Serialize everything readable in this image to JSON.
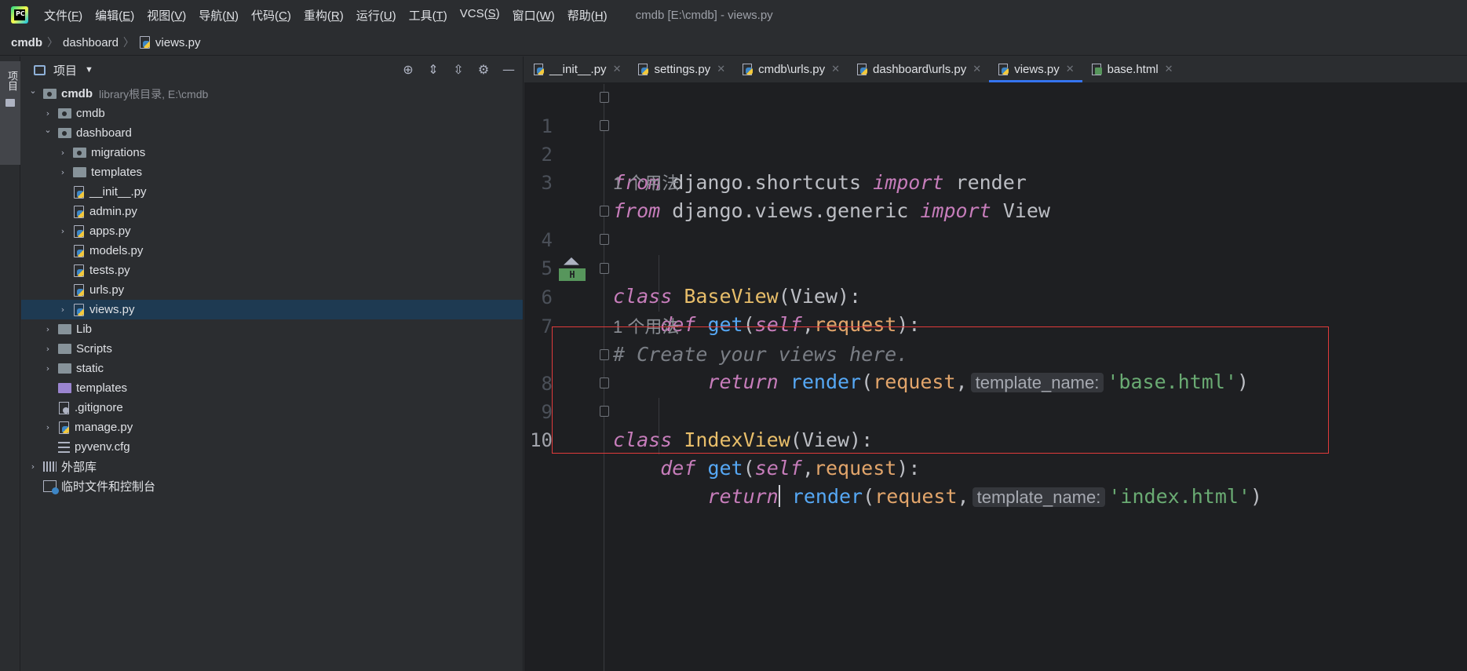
{
  "menubar": {
    "logo_text": "PC",
    "items": [
      {
        "label": "文件(",
        "key": "F",
        "end": ")"
      },
      {
        "label": "编辑(",
        "key": "E",
        "end": ")"
      },
      {
        "label": "视图(",
        "key": "V",
        "end": ")"
      },
      {
        "label": "导航(",
        "key": "N",
        "end": ")"
      },
      {
        "label": "代码(",
        "key": "C",
        "end": ")"
      },
      {
        "label": "重构(",
        "key": "R",
        "end": ")"
      },
      {
        "label": "运行(",
        "key": "U",
        "end": ")"
      },
      {
        "label": "工具(",
        "key": "T",
        "end": ")"
      },
      {
        "label": "VCS(",
        "key": "S",
        "end": ")"
      },
      {
        "label": "窗口(",
        "key": "W",
        "end": ")"
      },
      {
        "label": "帮助(",
        "key": "H",
        "end": ")"
      }
    ],
    "window_title": "cmdb [E:\\cmdb] - views.py"
  },
  "breadcrumb": {
    "items": [
      "cmdb",
      "dashboard",
      "views.py"
    ]
  },
  "toolstrip": {
    "project_tab": "项目"
  },
  "project_panel": {
    "title": "项目",
    "tree": [
      {
        "label": "cmdb",
        "hint": "library根目录, E:\\cmdb",
        "depth": 0,
        "chev": "open",
        "icon": "folder-module",
        "bold": true
      },
      {
        "label": "cmdb",
        "depth": 1,
        "chev": "closed",
        "icon": "folder-module"
      },
      {
        "label": "dashboard",
        "depth": 1,
        "chev": "open",
        "icon": "folder-module"
      },
      {
        "label": "migrations",
        "depth": 2,
        "chev": "closed",
        "icon": "folder-module"
      },
      {
        "label": "templates",
        "depth": 2,
        "chev": "closed",
        "icon": "folder"
      },
      {
        "label": "__init__.py",
        "depth": 2,
        "chev": "none",
        "icon": "python-file"
      },
      {
        "label": "admin.py",
        "depth": 2,
        "chev": "none",
        "icon": "python-file"
      },
      {
        "label": "apps.py",
        "depth": 2,
        "chev": "closed",
        "icon": "python-file"
      },
      {
        "label": "models.py",
        "depth": 2,
        "chev": "none",
        "icon": "python-file"
      },
      {
        "label": "tests.py",
        "depth": 2,
        "chev": "none",
        "icon": "python-file"
      },
      {
        "label": "urls.py",
        "depth": 2,
        "chev": "none",
        "icon": "python-file"
      },
      {
        "label": "views.py",
        "depth": 2,
        "chev": "closed",
        "icon": "python-file",
        "selected": true
      },
      {
        "label": "Lib",
        "depth": 1,
        "chev": "closed",
        "icon": "folder"
      },
      {
        "label": "Scripts",
        "depth": 1,
        "chev": "closed",
        "icon": "folder"
      },
      {
        "label": "static",
        "depth": 1,
        "chev": "closed",
        "icon": "folder"
      },
      {
        "label": "templates",
        "depth": 1,
        "chev": "none",
        "icon": "folder-templates"
      },
      {
        "label": ".gitignore",
        "depth": 1,
        "chev": "none",
        "icon": "git-file"
      },
      {
        "label": "manage.py",
        "depth": 1,
        "chev": "closed",
        "icon": "python-file"
      },
      {
        "label": "pyvenv.cfg",
        "depth": 1,
        "chev": "none",
        "icon": "config-file"
      },
      {
        "label": "外部库",
        "depth": 0,
        "chev": "closed",
        "icon": "library"
      },
      {
        "label": "临时文件和控制台",
        "depth": 0,
        "chev": "none",
        "icon": "scratch"
      }
    ]
  },
  "editor": {
    "tabs": [
      {
        "label": "__init__.py",
        "icon": "python-file"
      },
      {
        "label": "settings.py",
        "icon": "python-file"
      },
      {
        "label": "cmdb\\urls.py",
        "icon": "python-file"
      },
      {
        "label": "dashboard\\urls.py",
        "icon": "python-file"
      },
      {
        "label": "views.py",
        "icon": "python-file",
        "active": true
      },
      {
        "label": "base.html",
        "icon": "html-file"
      }
    ],
    "usage_hint": "1 个用法",
    "gutter_badge": "H",
    "inlay_hint": "template_name:",
    "line_numbers": [
      "1",
      "2",
      "3",
      "4",
      "5",
      "6",
      "7",
      "8",
      "9",
      "10"
    ],
    "code": {
      "l1": {
        "kw1": "from",
        "t1": " django.shortcuts ",
        "kw2": "import",
        "t2": " render"
      },
      "l2": {
        "kw1": "from",
        "t1": " django.views.generic ",
        "kw2": "import",
        "t2": " View"
      },
      "l4": {
        "kw": "class",
        "sp": " ",
        "cls": "BaseView",
        "rest": "(View):"
      },
      "l5": {
        "indent": "    ",
        "kw": "def",
        "sp": " ",
        "fn": "get",
        "p1": "(",
        "self": "self",
        "c": ",",
        "prm": "request",
        "p2": "):"
      },
      "l6": {
        "indent": "        ",
        "kw": "return",
        "sp": " ",
        "fn": "render",
        "p1": "(",
        "prm": "request",
        "c": ",",
        "str": "'base.html'",
        "p2": ")"
      },
      "l7": {
        "cmt": "# Create your views here."
      },
      "l8": {
        "kw": "class",
        "sp": " ",
        "cls": "IndexView",
        "rest": "(View):"
      },
      "l9": {
        "indent": "    ",
        "kw": "def",
        "sp": " ",
        "fn": "get",
        "p1": "(",
        "self": "self",
        "c": ",",
        "prm": "request",
        "p2": "):"
      },
      "l10": {
        "indent": "        ",
        "kw": "return",
        "sp": " ",
        "fn": "render",
        "p1": "(",
        "prm": "request",
        "c": ",",
        "str": "'index.html'",
        "p2": ")"
      }
    }
  }
}
